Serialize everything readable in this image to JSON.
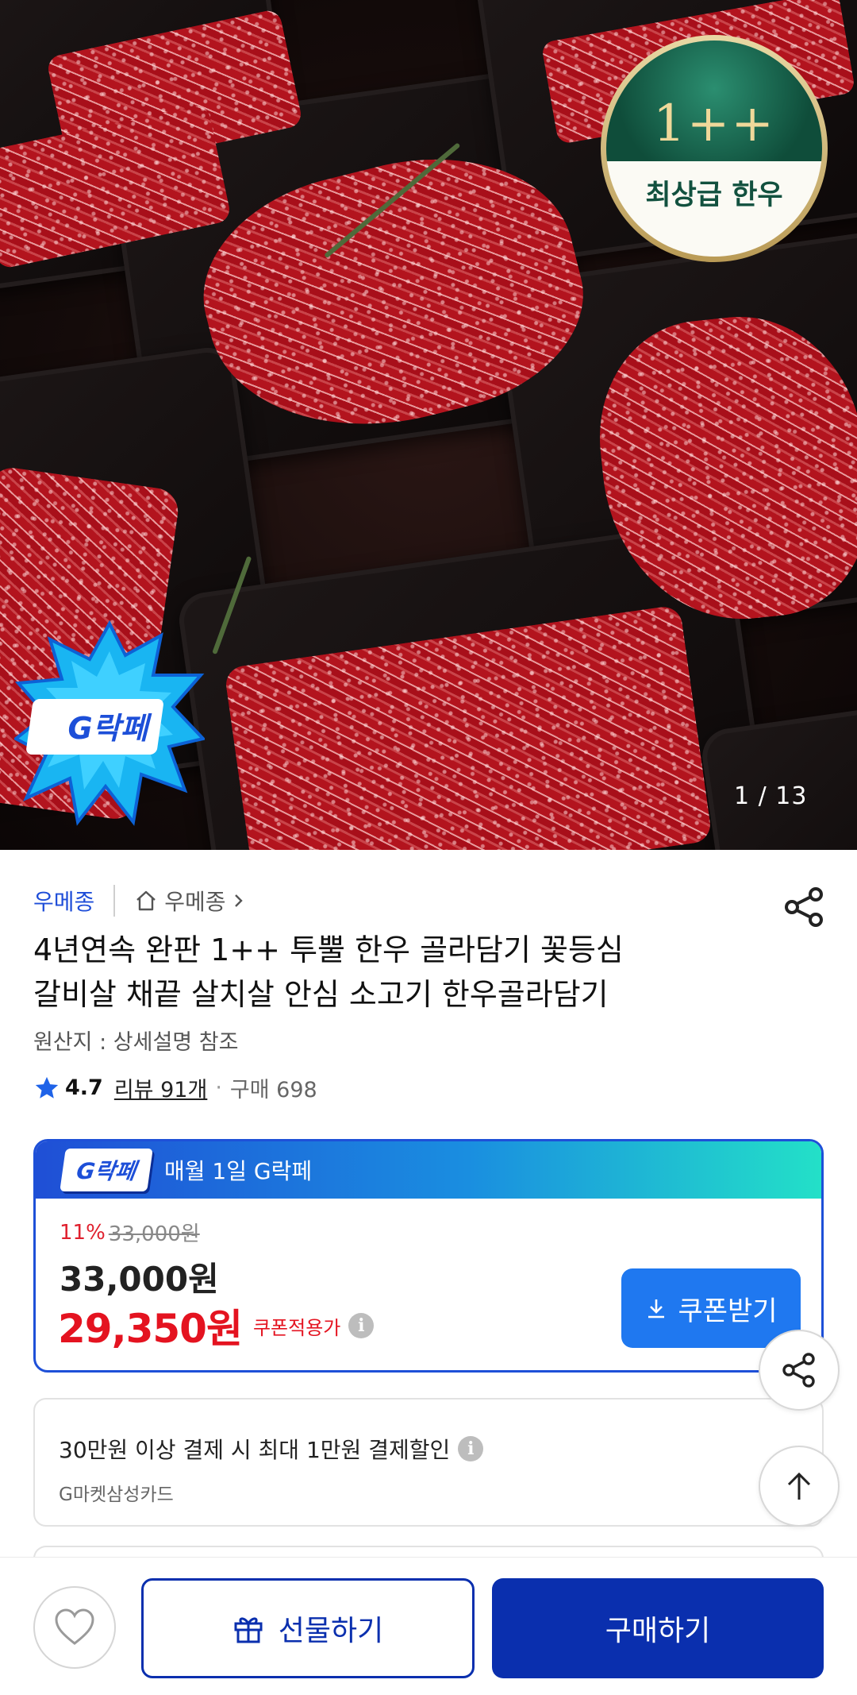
{
  "hero": {
    "grade_badge_grade": "1++",
    "grade_badge_label": "최상급 한우",
    "burst_logo_text": "G락페",
    "image_counter": "1 / 13"
  },
  "store": {
    "name": "우메종",
    "home_label": "우메종"
  },
  "product": {
    "title_line1": "4년연속 완판 1++ 투뿔 한우 골라담기 꽃등심",
    "title_line2": "갈비살 채끝 살치살 안심 소고기 한우골라담기",
    "origin": "원산지 : 상세설명 참조",
    "rating": "4.7",
    "review_count": "리뷰 91개",
    "purchase_count": "구매 698"
  },
  "price_card": {
    "logo_text": "G락페",
    "banner_text": "매월 1일 G락페",
    "discount_percent": "11%",
    "original_price": "33,000원",
    "price": "33,000원",
    "coupon_price": "29,350원",
    "coupon_label": "쿠폰적용가",
    "coupon_button": "쿠폰받기"
  },
  "card_promo": {
    "main_text": "30만원 이상 결제 시 최대 1만원 결제할인",
    "sub_text": "G마켓삼성카드"
  },
  "bottom_bar": {
    "gift_label": "선물하기",
    "buy_label": "구매하기"
  },
  "colors": {
    "brand_blue": "#0a2fae",
    "coupon_red": "#e41320",
    "coupon_button": "#1f78f0"
  }
}
